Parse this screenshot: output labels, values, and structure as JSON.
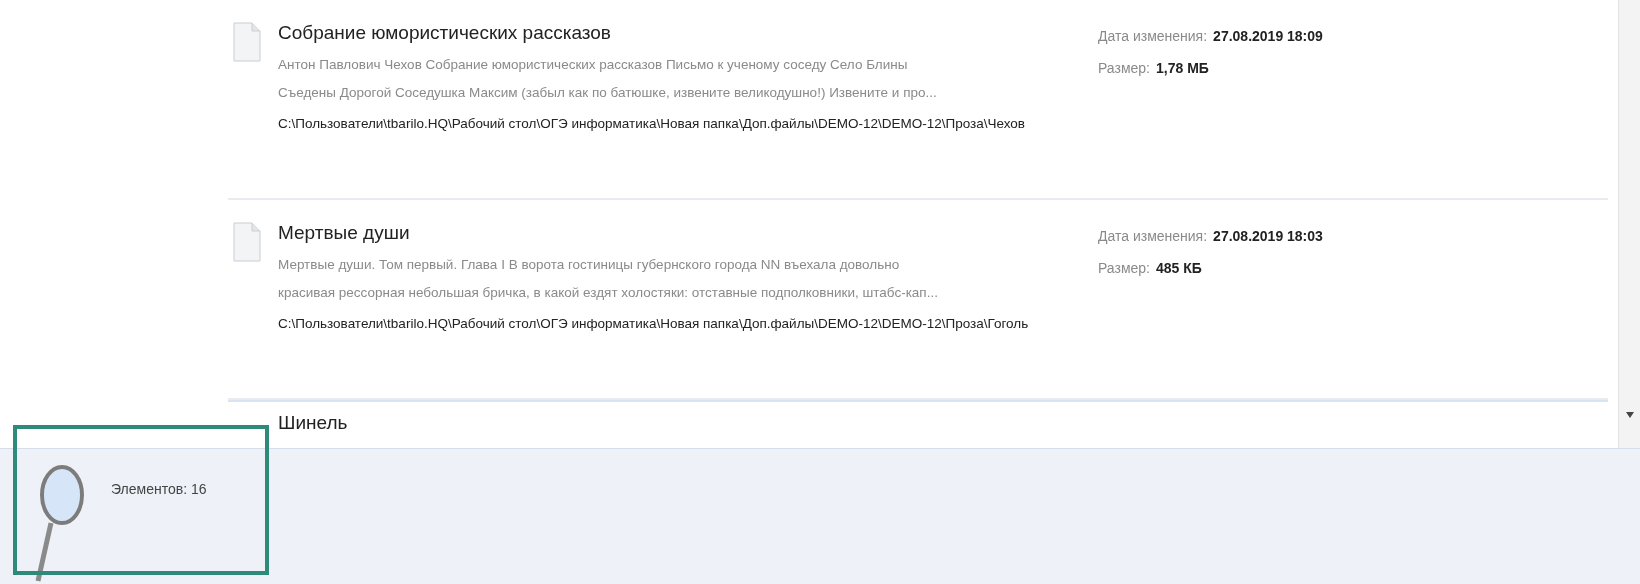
{
  "results": [
    {
      "title": "Собрание юмористических рассказов",
      "snippet": [
        "Антон Павлович Чехов Собрание юмористических рассказов Письмо к ученому соседу Село Блины",
        "Съедены Дорогой Соседушка Максим (забыл как по батюшке, извените великодушно!) Извените и про..."
      ],
      "path": "C:\\Пользователи\\tbarilo.HQ\\Рабочий стол\\ОГЭ информатика\\Новая папка\\Доп.файлы\\DEMO-12\\DEMO-12\\Проза\\Чехов",
      "date_label": "Дата изменения:",
      "date": "27.08.2019 18:09",
      "size_label": "Размер:",
      "size": "1,78 МБ"
    },
    {
      "title": "Мертвые души",
      "snippet": [
        "Мертвые души. Том первый. Глава I В ворота гостиницы губернского города NN въехала довольно",
        "красивая рессорная небольшая бричка, в какой ездят холостяки: отставные подполковники, штабс-кап..."
      ],
      "path": "C:\\Пользователи\\tbarilo.HQ\\Рабочий стол\\ОГЭ информатика\\Новая папка\\Доп.файлы\\DEMO-12\\DEMO-12\\Проза\\Гоголь",
      "date_label": "Дата изменения:",
      "date": "27.08.2019 18:03",
      "size_label": "Размер:",
      "size": "485 КБ"
    }
  ],
  "cut_off_item": {
    "title": "Шинель"
  },
  "status": {
    "count": "Элементов: 16"
  }
}
